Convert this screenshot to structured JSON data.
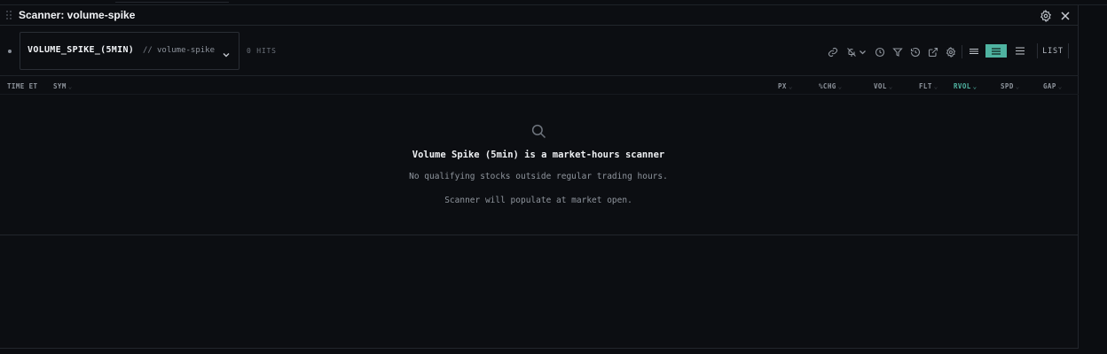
{
  "panel": {
    "title": "Scanner: volume-spike"
  },
  "scanner": {
    "name": "VOLUME_SPIKE_(5MIN)",
    "separator": "//",
    "slug": "volume-spike",
    "hits": "0 HITS"
  },
  "toolbar": {
    "icons": [
      "link-icon",
      "bell-off-icon",
      "chevron-down-icon",
      "clock-icon",
      "filter-icon",
      "history-icon",
      "external-link-icon",
      "gear-icon"
    ],
    "views": [
      "compact-view-icon",
      "comfortable-view-icon",
      "list-view-icon"
    ],
    "active_view": "comfortable-view-icon",
    "list_label": "LIST"
  },
  "columns": {
    "time": "TIME ET",
    "sym": "SYM",
    "px": "PX",
    "chg": "%CHG",
    "vol": "VOL",
    "flt": "FLT",
    "rvol": "RVOL",
    "spd": "SPD",
    "gap": "GAP",
    "sorted_by": "RVOL"
  },
  "empty_state": {
    "icon": "search-icon",
    "title": "Volume Spike (5min) is a market-hours scanner",
    "subtitle": "No qualifying stocks outside regular trading hours.",
    "note": "Scanner will populate at market open."
  },
  "colors": {
    "accent": "#4fb3a1",
    "background": "#0c0e12",
    "border": "#22262c"
  }
}
